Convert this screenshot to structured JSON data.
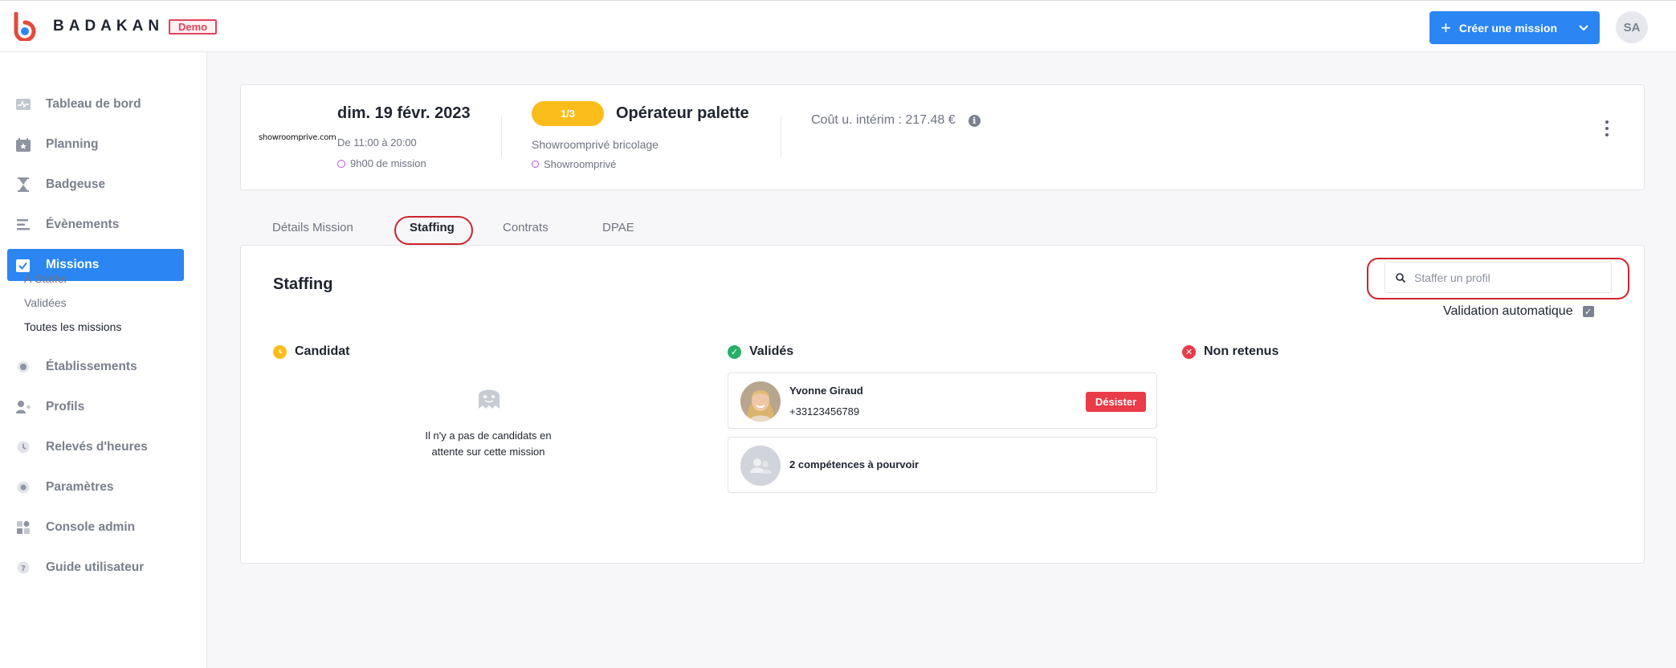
{
  "app": {
    "brand": "BADAKAN",
    "badge": "Demo",
    "user_initials": "SA"
  },
  "header": {
    "create_label": "Créer une mission"
  },
  "colors": {
    "accent": "#2b86f4",
    "danger": "#ea3b48",
    "highlight_ring": "#d0232c",
    "pill": "#fbbd1c",
    "valid": "#27b067",
    "pending": "#fbbd1c"
  },
  "sidebar": {
    "items": [
      {
        "label": "Tableau de bord",
        "icon": "dashboard-icon"
      },
      {
        "label": "Planning",
        "icon": "calendar-icon"
      },
      {
        "label": "Badgeuse",
        "icon": "hourglass-icon"
      },
      {
        "label": "Évènements",
        "icon": "events-icon"
      },
      {
        "label": "Missions",
        "icon": "missions-icon",
        "active": true
      },
      {
        "label": "Établissements",
        "icon": "establishment-icon"
      },
      {
        "label": "Profils",
        "icon": "profile-icon"
      },
      {
        "label": "Relevés d'heures",
        "icon": "clock-icon"
      },
      {
        "label": "Paramètres",
        "icon": "settings-icon"
      },
      {
        "label": "Console admin",
        "icon": "admin-icon"
      },
      {
        "label": "Guide utilisateur",
        "icon": "help-icon"
      }
    ],
    "subitems": [
      "À Staffer",
      "Validées",
      "Toutes les missions"
    ]
  },
  "mission": {
    "client_logo": "showroomprive.com",
    "date": "dim. 19 févr. 2023",
    "hours": "De 11:00 à 20:00",
    "duration": "9h00 de mission",
    "ratio": "1/3",
    "title": "Opérateur palette",
    "site": "Showroomprivé bricolage",
    "client": "Showroomprivé",
    "cost": "Coût u. intérim : 217.48 €"
  },
  "tabs": [
    "Détails Mission",
    "Staffing",
    "Contrats",
    "DPAE"
  ],
  "staffing": {
    "title": "Staffing",
    "search_placeholder": "Staffer un profil",
    "auto_validation": "Validation automatique",
    "columns": {
      "candidat": "Candidat",
      "valides": "Validés",
      "non_retenus": "Non retenus"
    },
    "empty_text": "Il n'y a pas de candidats en attente sur cette mission",
    "validated": [
      {
        "name": "Yvonne Giraud",
        "phone": "+33123456789",
        "action": "Désister"
      }
    ],
    "skills_text": "2 compétences à pourvoir"
  }
}
